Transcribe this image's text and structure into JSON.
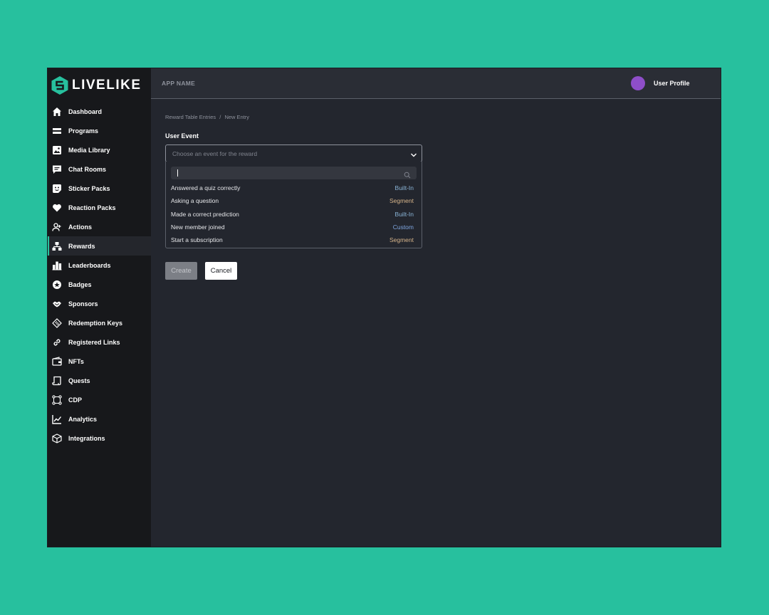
{
  "brand": {
    "name": "LIVELIKE",
    "accent": "#27c09e"
  },
  "topbar": {
    "app_name": "APP NAME",
    "profile_label": "User Profile",
    "avatar_color": "#8e4ec9"
  },
  "sidebar": {
    "items": [
      {
        "label": "Dashboard",
        "icon": "home-icon"
      },
      {
        "label": "Programs",
        "icon": "programs-icon"
      },
      {
        "label": "Media Library",
        "icon": "image-icon"
      },
      {
        "label": "Chat Rooms",
        "icon": "chat-icon"
      },
      {
        "label": "Sticker Packs",
        "icon": "sticker-icon"
      },
      {
        "label": "Reaction Packs",
        "icon": "heart-icon"
      },
      {
        "label": "Actions",
        "icon": "user-plus-icon"
      },
      {
        "label": "Rewards",
        "icon": "rewards-icon",
        "active": true
      },
      {
        "label": "Leaderboards",
        "icon": "leaderboard-icon"
      },
      {
        "label": "Badges",
        "icon": "badge-icon"
      },
      {
        "label": "Sponsors",
        "icon": "sponsor-icon"
      },
      {
        "label": "Redemption Keys",
        "icon": "ticket-icon"
      },
      {
        "label": "Registered Links",
        "icon": "link-icon"
      },
      {
        "label": "NFTs",
        "icon": "wallet-icon"
      },
      {
        "label": "Quests",
        "icon": "scroll-icon"
      },
      {
        "label": "CDP",
        "icon": "graph-icon"
      },
      {
        "label": "Analytics",
        "icon": "chart-icon"
      },
      {
        "label": "Integrations",
        "icon": "cube-icon"
      }
    ]
  },
  "breadcrumb": {
    "parent": "Reward Table Entries",
    "separator": "/",
    "current": "New Entry"
  },
  "form": {
    "field_label": "User Event",
    "select_placeholder": "Choose an event for the reward",
    "search_value": "",
    "options": [
      {
        "name": "Answered a quiz correctly",
        "type": "Built-In",
        "color": "#8ab4d6"
      },
      {
        "name": "Asking a question",
        "type": "Segment",
        "color": "#d6b48a"
      },
      {
        "name": "Made a correct prediction",
        "type": "Built-In",
        "color": "#8ab4d6"
      },
      {
        "name": "New member joined",
        "type": "Custom",
        "color": "#7fa6e0"
      },
      {
        "name": "Start a subscription",
        "type": "Segment",
        "color": "#d6b48a"
      }
    ],
    "create_label": "Create",
    "cancel_label": "Cancel"
  }
}
